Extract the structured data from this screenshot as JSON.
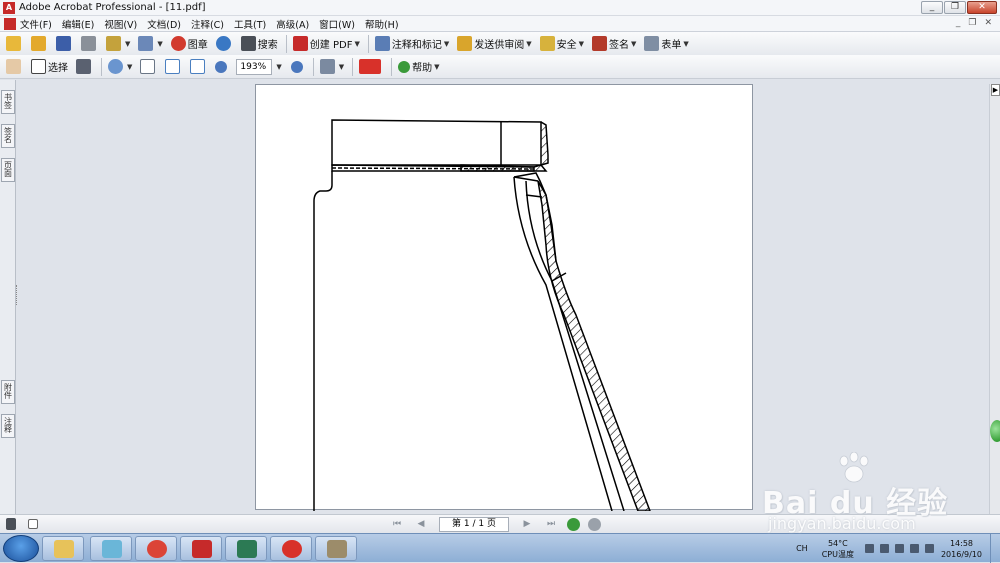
{
  "window": {
    "title": "Adobe Acrobat Professional - [11.pdf]"
  },
  "menu": {
    "items": [
      "文件(F)",
      "编辑(E)",
      "视图(V)",
      "文档(D)",
      "注释(C)",
      "工具(T)",
      "高级(A)",
      "窗口(W)",
      "帮助(H)"
    ]
  },
  "toolbar1": {
    "stamp": "图章",
    "search": "搜索",
    "create_pdf": "创建 PDF",
    "comment_markup": "注释和标记",
    "send_review": "发送供审阅",
    "security": "安全",
    "sign": "签名",
    "forms": "表单"
  },
  "toolbar2": {
    "select": "选择",
    "zoom_value": "193%",
    "help": "帮助"
  },
  "left_tabs": {
    "top": [
      "书签",
      "签名",
      "页面"
    ],
    "bottom": [
      "附件",
      "注释"
    ]
  },
  "status": {
    "page_indicator": "第 1 / 1 页"
  },
  "taskbar": {
    "lang": "CH",
    "temp": "54°C",
    "temp_label": "CPU温度",
    "time": "14:58",
    "date": "2016/9/10"
  },
  "watermark": {
    "brand": "Bai du 经验",
    "url": "jingyan.baidu.com"
  },
  "colors": {
    "accent_red": "#c62a2a",
    "taskbar": "#8daed5",
    "page_bg": "#ffffff",
    "work_bg": "#dfe3ea"
  }
}
